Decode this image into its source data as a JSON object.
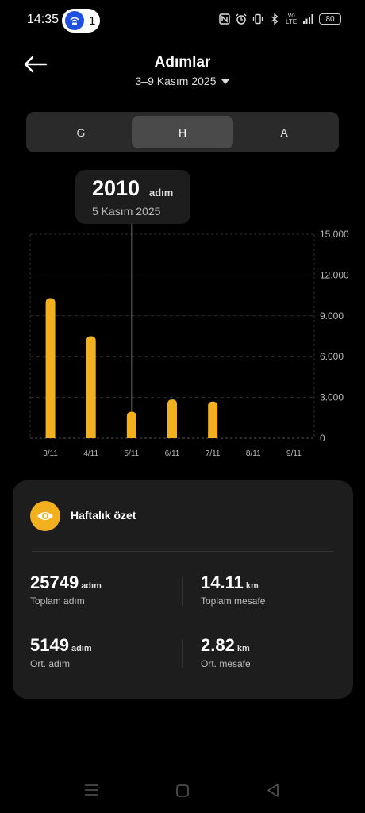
{
  "status_bar": {
    "time": "14:35",
    "hotspot_count": "1",
    "signal_label": "Vo LTE",
    "battery": "80"
  },
  "header": {
    "title": "Adımlar",
    "date_range": "3–9 Kasım 2025"
  },
  "tabs": [
    {
      "label": "G",
      "active": false
    },
    {
      "label": "H",
      "active": true
    },
    {
      "label": "A",
      "active": false
    }
  ],
  "tooltip": {
    "value": "2010",
    "unit": "adım",
    "date": "5 Kasım 2025"
  },
  "chart_data": {
    "type": "bar",
    "categories": [
      "3/11",
      "4/11",
      "5/11",
      "6/11",
      "7/11",
      "8/11",
      "9/11"
    ],
    "values": [
      10300,
      7500,
      1950,
      2850,
      2700,
      0,
      0
    ],
    "ylim": [
      0,
      15000
    ],
    "y_ticks": [
      "0",
      "3.000",
      "6.000",
      "9.000",
      "12.000",
      "15.000"
    ],
    "y_tick_values": [
      0,
      3000,
      6000,
      9000,
      12000,
      15000
    ],
    "selected_index": 2,
    "bar_color": "#f2b01e",
    "grid": true
  },
  "summary": {
    "title": "Haftalık özet",
    "stats": [
      {
        "value": "25749",
        "unit": "adım",
        "label": "Toplam adım"
      },
      {
        "value": "14.11",
        "unit": "km",
        "label": "Toplam mesafe"
      },
      {
        "value": "5149",
        "unit": "adım",
        "label": "Ort. adım"
      },
      {
        "value": "2.82",
        "unit": "km",
        "label": "Ort. mesafe"
      }
    ]
  },
  "colors": {
    "accent": "#f2b01e",
    "card": "#1d1d1d"
  }
}
